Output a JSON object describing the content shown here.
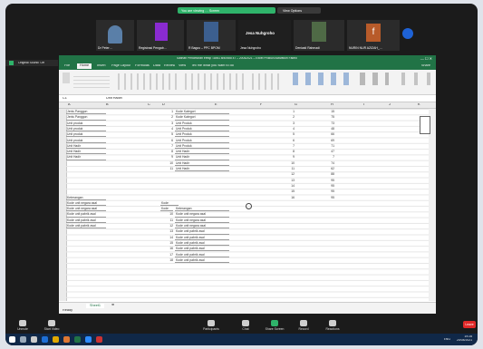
{
  "zoom": {
    "banner_share": "You are viewing … Screen",
    "banner_options": "View Options",
    "participants": [
      {
        "name": "Dr Peter…"
      },
      {
        "name": "Registrasi Pengab…"
      },
      {
        "name": "R Bagus – PPC BPOM"
      },
      {
        "name": "Jesa Nuhgroho"
      },
      {
        "name": "Deniasti Rahmadi"
      },
      {
        "name": "NURIN NUR AZIZAH_…"
      }
    ],
    "active_speaker": "Jesa Nuhgroho",
    "avatar_letter": "f",
    "controls": [
      "Unmute",
      "Start Video",
      "Participants",
      "Chat",
      "Share Screen",
      "Record",
      "Reactions"
    ],
    "leave": "Leave"
  },
  "excel": {
    "title": "Salinan Penomoran eresp TANG ara bold 47 – 20042021 – Excel Product Activation Failed",
    "left_tab": "Original Sound: Off",
    "tabs": [
      "File",
      "Home",
      "Insert",
      "Page Layout",
      "Formulas",
      "Data",
      "Review",
      "View",
      "Tell me what you want to do"
    ],
    "share": "Share",
    "name_box": "C1",
    "formula": "Unit Hadiri",
    "columns": [
      "A",
      "B",
      "C",
      "D",
      "E",
      "F",
      "G",
      "H",
      "I",
      "J",
      "K"
    ],
    "col_b": [
      "Jenis Panggon",
      "Jenis Panggon",
      "Unit produk",
      "Unit produk",
      "Unit produk",
      "Unit produk",
      "Unit Hadir",
      "Unit Hadir",
      "Unit Hadir"
    ],
    "col_e_codes": [
      "1",
      "2",
      "3",
      "4",
      "5",
      "6",
      "7",
      "8",
      "9",
      "10",
      "11"
    ],
    "col_e": [
      "Kode Kategori",
      "Kode Kategori",
      "Unit Produk",
      "Unit Produk",
      "Unit Produk",
      "Unit Produk",
      "Unit Produk",
      "Unit Hadir",
      "Unit Hadir",
      "Unit Hadir",
      "Unit Hadir"
    ],
    "col_g": [
      "1",
      "2",
      "3",
      "4",
      "5",
      "6",
      "7",
      "8",
      "9",
      "10",
      "11",
      "12",
      "13",
      "14",
      "15",
      "16"
    ],
    "col_h": [
      "15",
      "75",
      "73",
      "48",
      "66",
      "69",
      "71",
      "47",
      "7",
      "74",
      "62",
      "88",
      "95",
      "95",
      "95",
      "95"
    ],
    "b2_header": "Keterangan",
    "b2": [
      "Kode unit negara asal",
      "Kode unit negara asal",
      "Kode unit pabrik asal",
      "Kode unit pabrik asal",
      "Kode unit pabrik asal"
    ],
    "e2_label": "Kode",
    "e2_header": "Keterangan",
    "e2_caption": "Kode",
    "e2_codes": [
      "10",
      "11",
      "12",
      "13",
      "14",
      "15",
      "16",
      "17",
      "18"
    ],
    "e2": [
      "Kode unit negara asal",
      "Kode unit negara asal",
      "Kode unit negara asal",
      "Kode unit pabrik asal",
      "Kode unit pabrik asal",
      "Kode unit pabrik asal",
      "Kode unit pabrik asal",
      "Kode unit pabrik asal",
      "Kode unit pabrik asal"
    ],
    "sheet": "Sheet1",
    "status": "Ready"
  },
  "taskbar": {
    "time": "19:28",
    "date": "20/04/2021",
    "lang": "ENG"
  }
}
